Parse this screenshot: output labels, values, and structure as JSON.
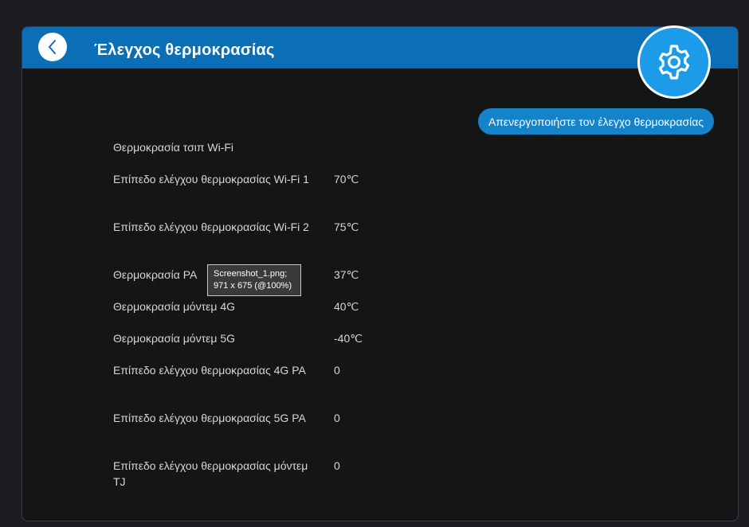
{
  "header": {
    "title": "Έλεγχος θερμοκρασίας",
    "back_icon": "chevron-left-icon",
    "settings_icon": "gear-icon",
    "color": "#0a6fb6"
  },
  "action": {
    "disable_label": "Απενεργοποιήστε τον έλεγχο θερμοκρασίας"
  },
  "rows": [
    {
      "label": "Θερμοκρασία τσιπ Wi-Fi",
      "value": ""
    },
    {
      "label": "Επίπεδο ελέγχου θερμοκρασίας Wi-Fi 1",
      "value": "70℃"
    },
    {
      "label": "Επίπεδο ελέγχου θερμοκρασίας Wi-Fi 2",
      "value": "75℃"
    },
    {
      "label": "Θερμοκρασία PA",
      "value": "37℃"
    },
    {
      "label": "Θερμοκρασία μόντεμ 4G",
      "value": "40℃"
    },
    {
      "label": "Θερμοκρασία μόντεμ 5G",
      "value": "-40℃"
    },
    {
      "label": "Επίπεδο ελέγχου θερμοκρασίας 4G PA",
      "value": "0"
    },
    {
      "label": "Επίπεδο ελέγχου θερμοκρασίας 5G PA",
      "value": "0"
    },
    {
      "label": "Επίπεδο ελέγχου θερμοκρασίας μόντεμ TJ",
      "value": "0"
    }
  ],
  "tooltip": {
    "line1": "Screenshot_1.png;",
    "line2": "971 x 675 (@100%)"
  },
  "colors": {
    "accent": "#1b9be8",
    "button": "#1483c9",
    "background": "#141517"
  }
}
